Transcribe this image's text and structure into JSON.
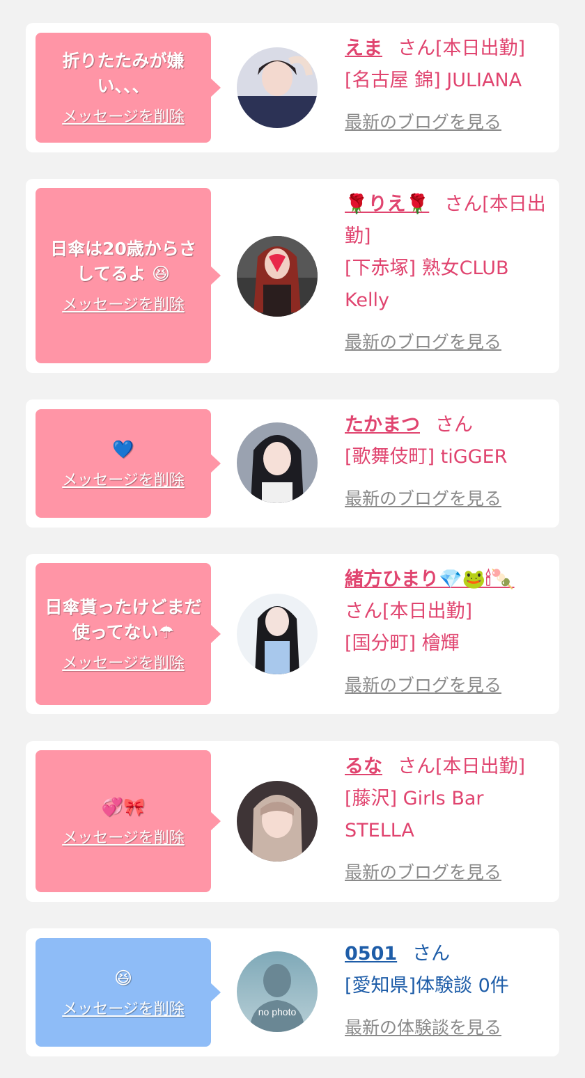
{
  "delete_label": "メッセージを削除",
  "cards": [
    {
      "message": "折りたたみが嫌い、、、",
      "name": "えま",
      "suffix": "さん[本日出勤]",
      "shop": "[名古屋 錦] JULIANA",
      "blog_link": "最新のブログを見る"
    },
    {
      "message": "日傘は20歳からさしてるよ 😆",
      "name": "🌹りえ🌹",
      "suffix": "さん[本日出勤]",
      "shop": "[下赤塚] 熟女CLUB Kelly",
      "blog_link": "最新のブログを見る"
    },
    {
      "message": "💙",
      "name": "たかまつ",
      "suffix": "さん",
      "shop": "[歌舞伎町] tiGGER",
      "blog_link": "最新のブログを見る"
    },
    {
      "message": "日傘貰ったけどまだ使ってない☂",
      "name": "緒方ひまり💎🐸🕯🍡",
      "suffix": "さん[本日出勤]",
      "shop": "[国分町] 檜輝",
      "blog_link": "最新のブログを見る"
    },
    {
      "message": "💞🎀",
      "name": "るな",
      "suffix": "さん[本日出勤]",
      "shop": "[藤沢] Girls Bar STELLA",
      "blog_link": "最新のブログを見る"
    },
    {
      "message": "😆",
      "name": "0501",
      "suffix": "さん",
      "shop": "[愛知県]体験談 0件",
      "blog_link": "最新の体験談を見る",
      "avatar_text": "no photo"
    }
  ],
  "colors": {
    "background": "#f2f2f2",
    "bubble_pink": "#ff95a6",
    "bubble_blue": "#8ebcf7",
    "name_pink": "#e0446f",
    "name_blue": "#1e5da8",
    "link_gray": "#8a8a8a"
  }
}
